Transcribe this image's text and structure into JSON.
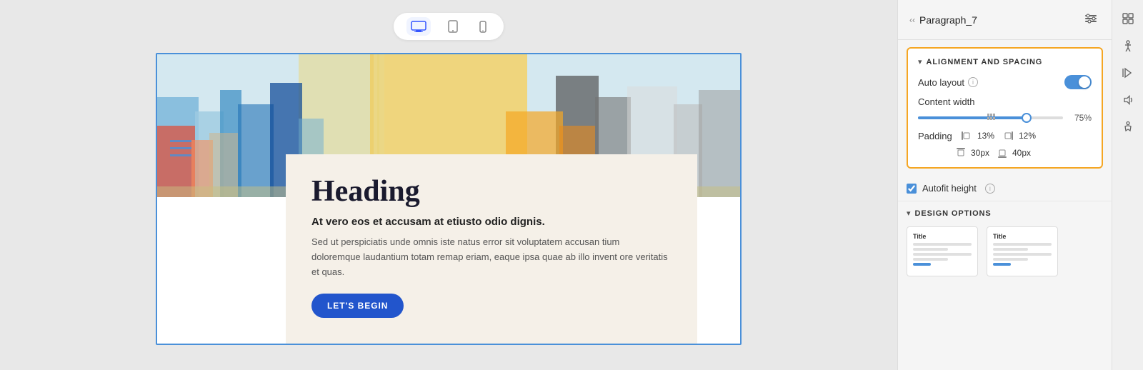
{
  "toolbar": {
    "device_desktop_label": "Desktop",
    "device_tablet_label": "Tablet",
    "device_mobile_label": "Mobile"
  },
  "content": {
    "heading": "Heading",
    "subheading": "At vero eos et accusam at etiusto odio dignis.",
    "body": "Sed ut perspiciatis unde omnis iste natus error sit voluptatem accusan tium doloremque laudantium totam remap eriam, eaque ipsa quae ab illo invent ore veritatis et quas.",
    "cta_button": "LET'S BEGIN"
  },
  "panel": {
    "title": "Paragraph_7",
    "back_label": "‹‹",
    "alignment_section_title": "ALIGNMENT AND SPACING",
    "auto_layout_label": "Auto layout",
    "content_width_label": "Content width",
    "content_width_value": "75%",
    "padding_label": "Padding",
    "padding_left_value": "13%",
    "padding_right_value": "12%",
    "padding_top_value": "30px",
    "padding_bottom_value": "40px",
    "autofit_label": "Autofit height",
    "design_options_title": "DESIGN OPTIONS",
    "design_card1_title": "Title",
    "design_card2_title": "Title"
  },
  "icons": {
    "monitor": "🖥",
    "tablet": "📱",
    "mobile": "📱",
    "info": "i",
    "accessibility": "♿",
    "animation": "⚡",
    "audio": "♪",
    "figure": "🚶"
  }
}
